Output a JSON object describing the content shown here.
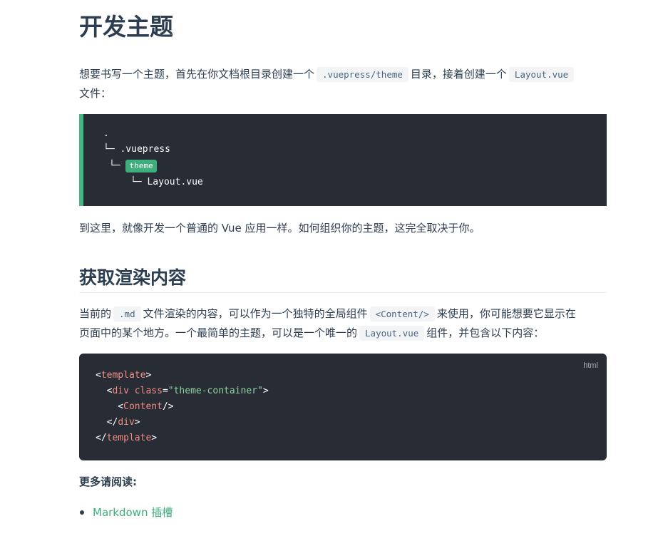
{
  "title": "开发主题",
  "intro": {
    "text1": "想要书写一个主题，首先在你文档根目录创建一个",
    "code1": ".vuepress/theme",
    "text2": "目录，接着创建一个",
    "code2": "Layout.vue",
    "text3": "文件："
  },
  "tree": {
    "root": ".",
    "vuepress": "└─ .vuepress",
    "theme_prefix": "└─",
    "theme": "theme",
    "layout": "└─ Layout.vue"
  },
  "after_tree": "到这里，就像开发一个普通的 Vue 应用一样。如何组织你的主题，这完全取决于你。",
  "section": {
    "heading": "获取渲染内容",
    "text1": "当前的",
    "code1": ".md",
    "text2": "文件渲染的内容，可以作为一个独特的全局组件",
    "code2": "<Content/>",
    "text3": "来使用，你可能想要它显示在",
    "text4": "页面中的某个地方。一个最简单的主题，可以是一个唯一的",
    "code3": "Layout.vue",
    "text5": "组件，并包含以下内容："
  },
  "code_block": {
    "lang": "html",
    "lines": {
      "l1_open": "<",
      "l1_tag": "template",
      "l1_close": ">",
      "l2_indent": "  <",
      "l2_tag": "div",
      "l2_attr": " class",
      "l2_eq": "=",
      "l2_str": "\"theme-container\"",
      "l2_close": ">",
      "l3_indent": "    <",
      "l3_tag": "Content",
      "l3_close": "/>",
      "l4_indent": "  </",
      "l4_tag": "div",
      "l4_close": ">",
      "l5_open": "</",
      "l5_tag": "template",
      "l5_close": ">"
    }
  },
  "more_reading": "更多请阅读:",
  "links": [
    {
      "label": "Markdown 插槽"
    }
  ],
  "colors": {
    "accent": "#3eaf7c",
    "text": "#2c3e50",
    "code_bg": "#282c34"
  }
}
